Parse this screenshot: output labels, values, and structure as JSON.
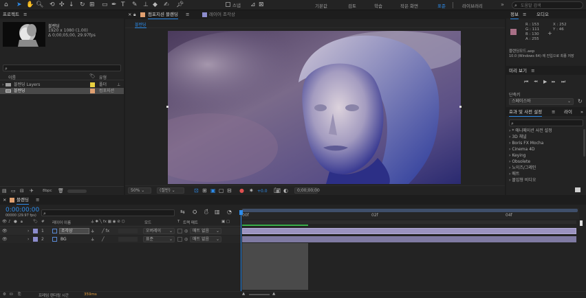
{
  "toolbar": {
    "menus": [
      "기본값",
      "검토",
      "학습",
      "작은 화면",
      "표준",
      "라이브러리"
    ],
    "active_menu": "표준",
    "overflow": "»",
    "search_placeholder": "도움말 검색",
    "snap_label": "스냅"
  },
  "project": {
    "title": "프로젝트",
    "thumb_name": "블렌딩",
    "thumb_info1": "1920 x 1080 (1.00)",
    "thumb_info2": "Δ 0;00;05;00, 29.97fps",
    "search_placeholder": "",
    "col_name": "이름",
    "col_type": "유형",
    "items": [
      {
        "name": "블렌딩 Layers",
        "type": "폴더",
        "color": "#e8d040"
      },
      {
        "name": "블렌딩",
        "type": "컴포지션",
        "color": "#e0a070"
      }
    ],
    "footer_bpc": "8bpc"
  },
  "comp_panel": {
    "tab_label": "컴포지션 블렌딩",
    "layer_tab_label": "레이어 조각상",
    "breadcrumb": "블렌딩",
    "zoom": "50%",
    "resolution": "(절반)",
    "exposure": "+0.0",
    "timecode": "0;00;00;00"
  },
  "info": {
    "tab_info": "정보",
    "tab_audio": "오디오",
    "r": "R : 153",
    "g": "G : 111",
    "b": "B : 130",
    "a": "A : 255",
    "x": "X : 252",
    "y": "Y : 46",
    "swatch_color": "#a86f86",
    "file_name": "블렌딩모드.aep",
    "file_info": "10.0 (Windows 64) 에 진입으로 최종 저장"
  },
  "preview": {
    "title": "미리 보기",
    "shortcut_label": "단축키",
    "shortcut_value": "스페이스바"
  },
  "effects": {
    "title": "효과 및 사전 설정",
    "tab_library": "라이",
    "search_placeholder": "",
    "items": [
      "* 애니메이션 사전 설정",
      "3D 채널",
      "Boris FX Mocha",
      "Cinema 4D",
      "Keying",
      "Obsolete",
      "노이즈/그레인",
      "매트",
      "몰입형 비디오"
    ]
  },
  "timeline": {
    "tab_label": "블렌딩",
    "timecode": "0:00:00:00",
    "timecode_sub": "00000 (29.97 fps)",
    "search_placeholder": "",
    "col_layer_name": "레이어 이름",
    "col_mode": "모드",
    "col_t": "T",
    "col_trackmatte": "트랙 매트",
    "rulers": [
      "00f",
      "02f",
      "04f"
    ],
    "layers": [
      {
        "num": "1",
        "name": "조각상",
        "mode": "오버레이",
        "matte": "매트 없음",
        "selected": true
      },
      {
        "num": "2",
        "name": "BG",
        "mode": "표준",
        "matte": "매트 없음",
        "selected": false
      }
    ],
    "footer_label": "프레임 렌더링 시간",
    "footer_value": "359ms"
  }
}
